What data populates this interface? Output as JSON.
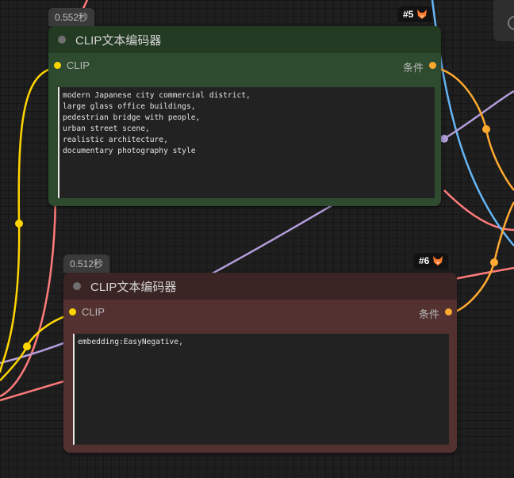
{
  "nodes": {
    "positive": {
      "id": "#5",
      "time": "0.552秒",
      "title": "CLIP文本编码器",
      "input_label": "CLIP",
      "output_label": "条件",
      "prompt": "modern Japanese city commercial district,\nlarge glass office buildings,\npedestrian bridge with people,\nurban street scene,\nrealistic architecture,\ndocumentary photography style"
    },
    "negative": {
      "id": "#6",
      "time": "0.512秒",
      "title": "CLIP文本编码器",
      "input_label": "CLIP",
      "output_label": "条件",
      "prompt": "embedding:EasyNegative,"
    }
  },
  "colors": {
    "positive_body": "#2f4b2f",
    "positive_header": "#233a23",
    "negative_body": "#543131",
    "negative_header": "#3b2424",
    "clip_wire": "#ffd500",
    "conditioning_wire": "#ffa931",
    "latent_wire": "#ff7b7b",
    "vae_wire": "#64b5f6",
    "model_wire": "#b39ddb"
  },
  "icons": [
    "fox-icon",
    "collapse-dot",
    "slot-dot"
  ]
}
